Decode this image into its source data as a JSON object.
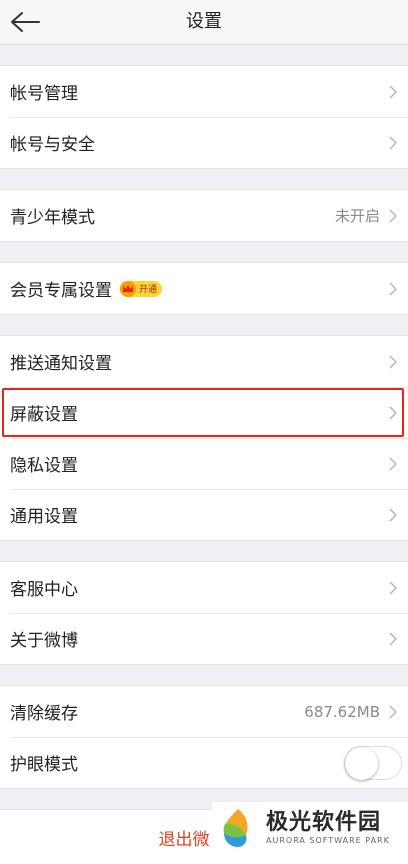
{
  "header": {
    "title": "设置"
  },
  "groups": {
    "account": {
      "items": [
        {
          "label": "帐号管理"
        },
        {
          "label": "帐号与安全"
        }
      ]
    },
    "youth": {
      "items": [
        {
          "label": "青少年模式",
          "value": "未开启"
        }
      ]
    },
    "member": {
      "items": [
        {
          "label": "会员专属设置",
          "badge": "开通"
        }
      ]
    },
    "settings": {
      "items": [
        {
          "label": "推送通知设置"
        },
        {
          "label": "屏蔽设置"
        },
        {
          "label": "隐私设置"
        },
        {
          "label": "通用设置"
        }
      ]
    },
    "help": {
      "items": [
        {
          "label": "客服中心"
        },
        {
          "label": "关于微博"
        }
      ]
    },
    "storage": {
      "items": [
        {
          "label": "清除缓存",
          "value": "687.62MB"
        },
        {
          "label": "护眼模式",
          "toggle_on": false
        }
      ]
    }
  },
  "logout": {
    "label": "退出微"
  },
  "watermark": {
    "title": "极光软件园",
    "subtitle": "AURORA SOFTWARE PARK"
  },
  "colors": {
    "highlight": "#e8251a",
    "logout": "#e0431f",
    "background": "#efeff4"
  }
}
